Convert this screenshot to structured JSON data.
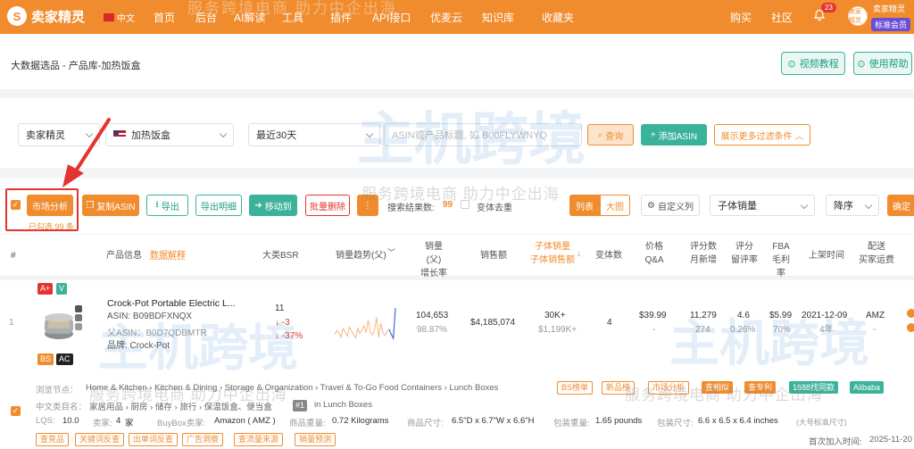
{
  "app": {
    "name": "卖家精灵",
    "logo_letter": "S",
    "lang": "中文"
  },
  "nav": {
    "items": [
      "首页",
      "后台",
      "AI解读",
      "工具",
      "插件",
      "API接口",
      "优麦云",
      "知识库",
      "收藏夹"
    ],
    "right": [
      "购买",
      "社区"
    ]
  },
  "header_banner": "服务跨境电商 助力中企出海",
  "user": {
    "notif_count": "23",
    "avatar_text": "卖家精灵",
    "name": "卖家精灵",
    "member": "标准会员"
  },
  "breadcrumb": "大数据选品 - 产品库-加热饭盒",
  "help": {
    "video": "视频教程",
    "guide": "使用帮助"
  },
  "filters": {
    "seller": "卖家精灵",
    "keyword": "加热饭盒",
    "range": "最近30天",
    "asin_placeholder": "ASIN或产品标题, 如 B00FLYWNYQ",
    "query": "查询",
    "add_asin": "添加ASIN",
    "more": "展示更多过滤条件"
  },
  "toolbar": {
    "market": "市场分析",
    "copy": "复制ASIN",
    "export": "导出",
    "export_detail": "导出明细",
    "move": "移动到",
    "batch_delete": "批量删除",
    "result_label": "搜索结果数:",
    "result_count": "99",
    "dedupe": "变体去重",
    "view_list": "列表",
    "view_grid": "大图",
    "custom_col": "自定义列",
    "sort_field": "子体销量",
    "sort_order": "降序",
    "confirm": "确定",
    "selected": "已勾选 99 条"
  },
  "columns": {
    "index": "#",
    "product": "产品信息",
    "product_link": "数据解释",
    "bsr": "大类BSR",
    "trend": "销量趋势(父)",
    "sales": [
      "销量(父)",
      "增长率"
    ],
    "revenue": "销售额",
    "child_sales": [
      "子体销量",
      "子体销售额"
    ],
    "variants": "变体数",
    "price": [
      "价格",
      "Q&A"
    ],
    "reviews": [
      "评分数",
      "月新增"
    ],
    "rating": [
      "评分",
      "留评率"
    ],
    "fba": [
      "FBA",
      "毛利率"
    ],
    "launch": "上架时间",
    "fulfil": [
      "配送",
      "买家运费"
    ]
  },
  "row": {
    "index": "1",
    "badges": [
      "A+",
      "V",
      "BS",
      "AC"
    ],
    "title": "Crock-Pot Portable Electric L...",
    "asin": "ASIN: B09BDFXNQX",
    "parent_asin": "父ASIN：B0D7QDBMTR",
    "brand": "品牌: Crock-Pot",
    "bsr": "11",
    "bsr_change": "↓ -3",
    "bsr_pct": "↓ -37%",
    "sales": "104,653",
    "sales_growth": "98.87%",
    "revenue": "$4,185,074",
    "child_sales": "30K+",
    "child_revenue": "$1,199K+",
    "variants": "4",
    "price": "$39.99",
    "qa": "-",
    "reviews": "11,279",
    "reviews_new": "274",
    "rating": "4.6",
    "review_rate": "0.26%",
    "fba": "$5.99",
    "margin": "70%",
    "launch": "2021-12-09",
    "launch_age": "4年",
    "fulfil": "AMZ",
    "fulfil_fee": "-",
    "browse_label": "浏览节点：",
    "browse": "Home & Kitchen › Kitchen & Dining › Storage & Organization › Travel & To-Go Food Containers › Lunch Boxes",
    "cn_label": "中文类目名：",
    "cn_cat": "家居用品 › 厨房 › 储存 › 旅行 › 保温饭盒、便当盒",
    "rank_badge": "#1",
    "rank_text": "in  Lunch Boxes",
    "quick_tags": [
      "BS榜单",
      "新品榜",
      "市场分析",
      "查相似",
      "查专利"
    ],
    "alibaba_1688": "1688找同款",
    "alibaba": "Alibaba",
    "lqs_label": "LQS:",
    "lqs": "10.0",
    "seller_label": "卖家:",
    "seller_count": "4",
    "seller_unit": "家",
    "buybox_label": "BuyBox卖家:",
    "buybox": "Amazon ( AMZ )",
    "weight_label": "商品重量:",
    "weight": "0.72 Kilograms",
    "size_label": "商品尺寸:",
    "size": "6.5\"D x 6.7\"W x 6.6\"H",
    "pack_w_label": "包装重量:",
    "pack_w": "1.65 pounds",
    "pack_s_label": "包装尺寸:",
    "pack_s": "6.6 x 6.5 x 6.4 inches",
    "pack_note": "(大号标准尺寸)",
    "actions": [
      "查竞品",
      "关键词反查",
      "出单词反查",
      "广告洞察",
      "查流量来源",
      "销量预测"
    ],
    "first_added_label": "首次加入时间:",
    "first_added": "2025-11-20"
  },
  "watermark": {
    "logo_text": "主机跨境",
    "tagline": "服务跨境电商 助力中企出海"
  },
  "colors": {
    "brand": "#f08c2d",
    "teal": "#3bb39a",
    "red": "#e3342f",
    "member": "#6b4cd6"
  },
  "trend_series": [
    55,
    48,
    52,
    60,
    45,
    50,
    58,
    42,
    49,
    55,
    61,
    44,
    53,
    47,
    40,
    52,
    30,
    50,
    56,
    48,
    25,
    60,
    35,
    52,
    57,
    50,
    46,
    55,
    62,
    8
  ]
}
